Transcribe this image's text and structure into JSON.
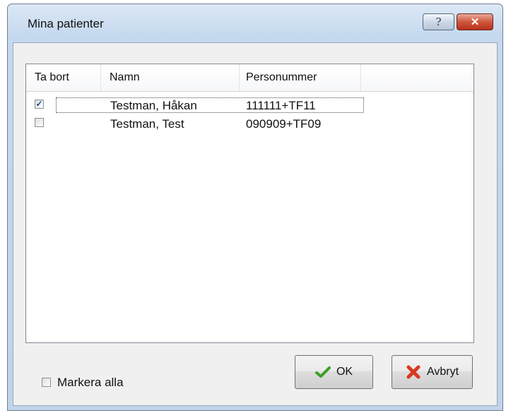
{
  "window": {
    "title": "Mina patienter",
    "help_glyph": "?",
    "close_glyph": "✕"
  },
  "list": {
    "columns": [
      "Ta bort",
      "Namn",
      "Personummer"
    ],
    "rows": [
      {
        "checked": true,
        "name": "Testman, Håkan",
        "pnr": "111111+TF11"
      },
      {
        "checked": false,
        "name": "Testman, Test",
        "pnr": "090909+TF09"
      }
    ]
  },
  "select_all": {
    "label": "Markera alla",
    "checked": false
  },
  "buttons": {
    "ok": "OK",
    "cancel": "Avbryt"
  },
  "icons": {
    "ok": "checkmark-icon",
    "cancel": "red-x-icon"
  },
  "colors": {
    "title_bg": "#c4d8ee",
    "close": "#c7432b",
    "checkmark": "#1d4a8c",
    "ok_icon": "#3aa024",
    "cancel_icon": "#d83a20"
  }
}
